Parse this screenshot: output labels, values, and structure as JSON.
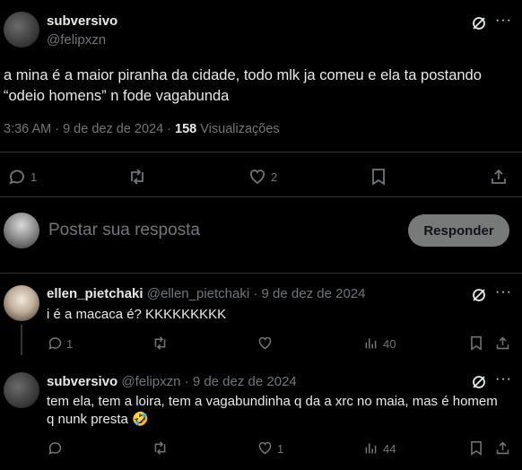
{
  "main_tweet": {
    "name": "subversivo",
    "handle": "@felipxzn",
    "text_line1": "a mina é a maior piranha da cidade, todo mlk ja comeu e ela ta postando",
    "text_line2": "“odeio homens” n fode vagabunda",
    "time_date": "3:36 AM · 9 de dez de 2024 · ",
    "views_count": "158",
    "views_label": "Visualizações",
    "reply_count": "1",
    "like_count": "2"
  },
  "compose": {
    "placeholder": "Postar sua resposta",
    "button_label": "Responder"
  },
  "replies": [
    {
      "name": "ellen_pietchaki",
      "handle": "@ellen_pietchaki",
      "date": "· 9 de dez de 2024",
      "text": "i é a macaca é? KKKKKKKKK",
      "reply_count": "1",
      "like_count": "",
      "views": "40"
    },
    {
      "name": "subversivo",
      "handle": "@felipxzn",
      "date": "· 9 de dez de 2024",
      "text_line1": "tem ela, tem a loira, tem a vagabundinha q da a xrc no maia, mas é homem",
      "text_line2": "q nunk presta 🤣",
      "reply_count": "",
      "like_count": "1",
      "views": "44"
    }
  ],
  "icons": {
    "more": "more-icon",
    "grok": "grok-icon"
  }
}
